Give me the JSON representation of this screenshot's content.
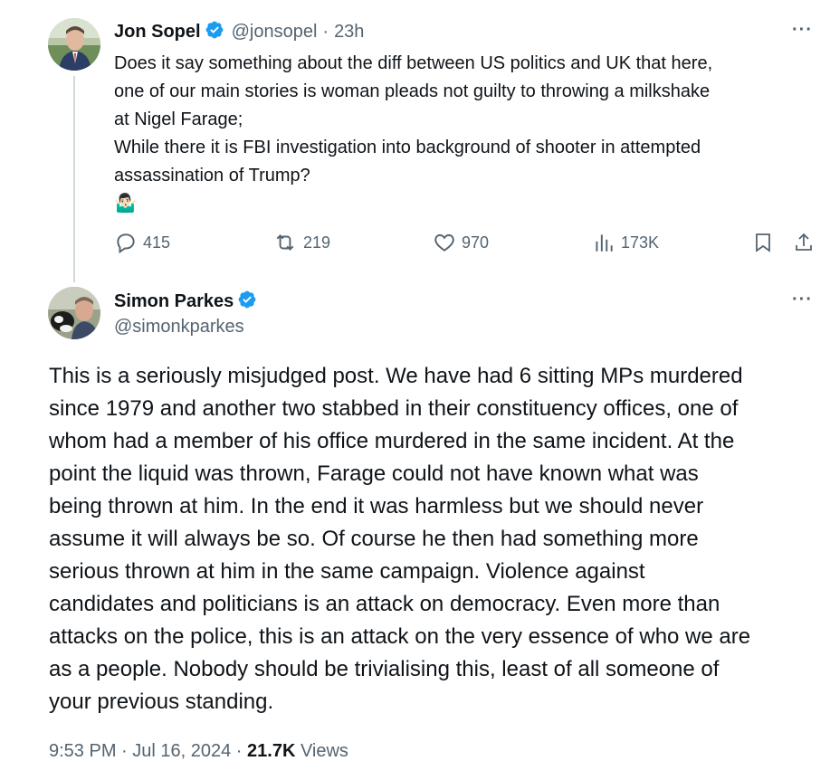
{
  "quoted_tweet": {
    "author_name": "Jon Sopel",
    "handle": "@jonsopel",
    "separator": "·",
    "time": "23h",
    "more_label": "···",
    "lines": [
      "Does it say something about the diff between US politics and UK that here,",
      "one of our main stories is woman pleads not guilty to throwing a milkshake",
      "at Nigel Farage;",
      "While there it is FBI investigation into background of shooter in attempted",
      "assassination of Trump?",
      "🤷🏻‍♂️"
    ],
    "actions": {
      "replies": "415",
      "reposts": "219",
      "likes": "970",
      "views": "173K"
    }
  },
  "main_tweet": {
    "author_name": "Simon Parkes",
    "handle": "@simonkparkes",
    "more_label": "···",
    "lines": [
      "This is a seriously misjudged post.  We have had 6 sitting MPs murdered",
      "since 1979 and another two stabbed in their constituency offices, one of",
      "whom had a member of his office murdered in the same incident.  At the",
      "point the liquid was thrown, Farage could not have known what was",
      "being thrown at him.  In the end it was harmless but we should never",
      "assume it will always be so. Of course he then had something more",
      "serious thrown at him in the same campaign.  Violence against",
      "candidates and politicians is an attack on democracy.  Even more than",
      "attacks on the police, this is an attack on the very essence of who we are",
      "as a people.   Nobody should be trivialising this, least of all someone of",
      "your previous standing."
    ],
    "timestamp": "9:53 PM · Jul 16, 2024 · ",
    "views_count": "21.7K",
    "views_label": " Views"
  },
  "colors": {
    "verified_blue": "#1d9bf0",
    "secondary_text": "#536471",
    "thread_line": "#cfd9de"
  }
}
